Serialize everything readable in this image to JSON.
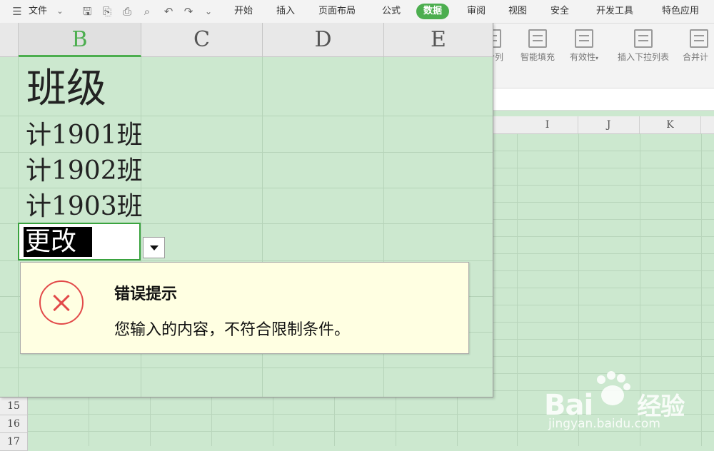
{
  "menubar": {
    "file_label": "文件",
    "tabs": [
      "开始",
      "插入",
      "页面布局",
      "公式",
      "数据",
      "审阅",
      "视图",
      "安全",
      "开发工具",
      "特色应用"
    ],
    "active_tab": "数据"
  },
  "ribbon": {
    "buttons": [
      "分列",
      "智能填充",
      "有效性",
      "插入下拉列表",
      "合并计"
    ]
  },
  "background_columns": [
    "I",
    "J",
    "K"
  ],
  "row_numbers": [
    "15",
    "16",
    "17"
  ],
  "zoom": {
    "columns": [
      "B",
      "C",
      "D",
      "E"
    ],
    "cells": [
      "班级",
      "计1901班",
      "计1902班",
      "计1903班"
    ],
    "editing_value": "更改"
  },
  "error_tip": {
    "title": "错误提示",
    "message": "您输入的内容，不符合限制条件。"
  },
  "watermark": {
    "brand_left": "Bai",
    "brand_right": "经验",
    "url": "jingyan.baidu.com"
  }
}
